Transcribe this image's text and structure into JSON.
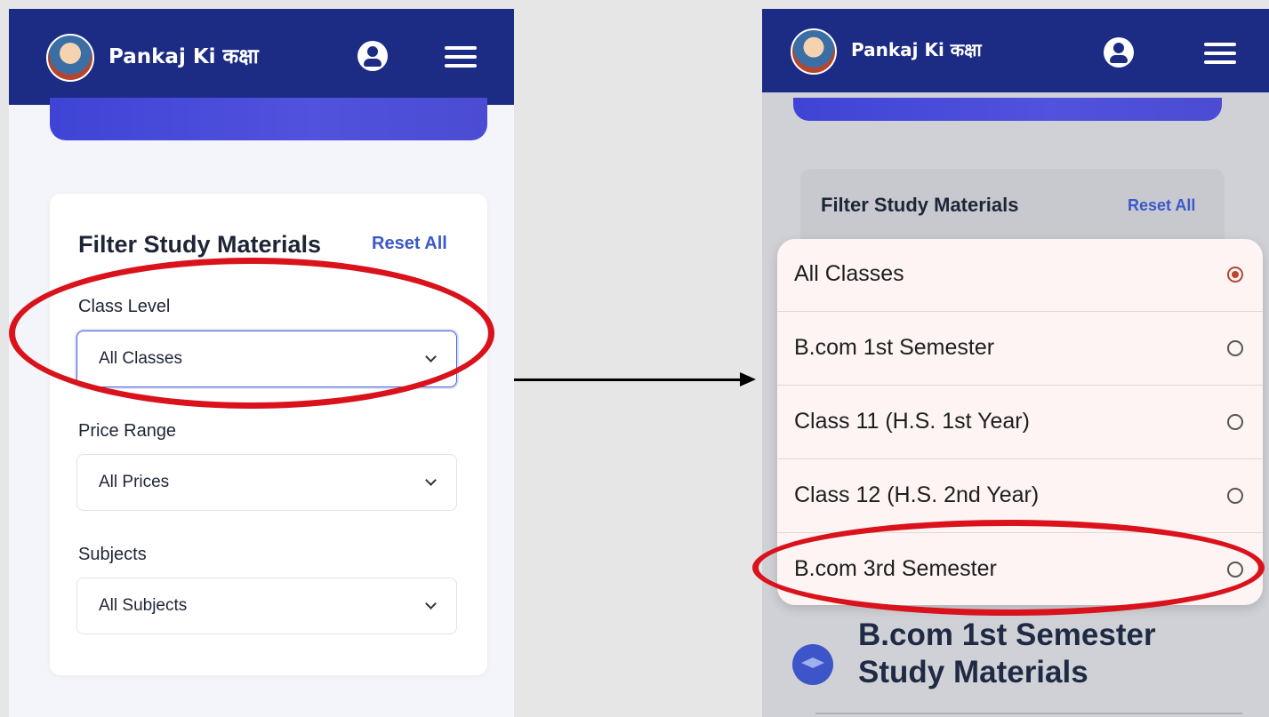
{
  "left": {
    "app_title": "Pankaj Ki कक्षा",
    "filter": {
      "title": "Filter Study Materials",
      "reset_label": "Reset All",
      "class_label": "Class Level",
      "class_value": "All Classes",
      "price_label": "Price Range",
      "price_value": "All Prices",
      "subject_label": "Subjects",
      "subject_value": "All Subjects"
    }
  },
  "right": {
    "app_title": "Pankaj Ki कक्षा",
    "filter_title": "Filter Study Materials",
    "reset_label": "Reset All",
    "options": [
      {
        "label": "All Classes",
        "selected": true
      },
      {
        "label": "B.com 1st Semester",
        "selected": false
      },
      {
        "label": "Class 11 (H.S. 1st Year)",
        "selected": false
      },
      {
        "label": "Class 12 (H.S. 2nd Year)",
        "selected": false
      },
      {
        "label": "B.com 3rd Semester",
        "selected": false
      }
    ],
    "section_title_line1": "B.com 1st Semester",
    "section_title_line2": "Study Materials"
  },
  "colors": {
    "header": "#1c2b84",
    "accent": "#3b58c9",
    "annotation": "#d9121c",
    "radio_selected": "#b8452f"
  }
}
